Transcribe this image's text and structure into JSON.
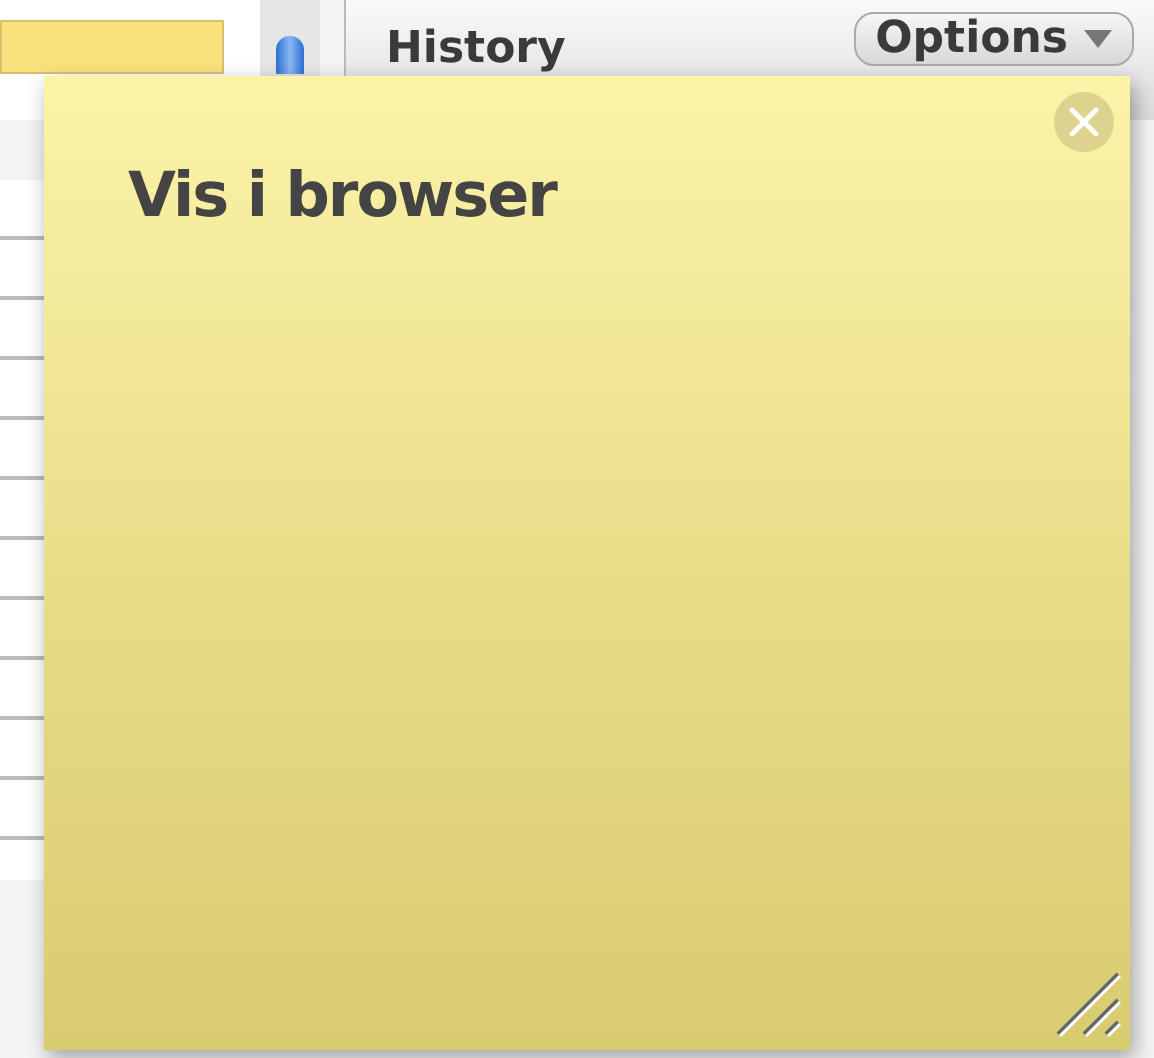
{
  "background": {
    "history_label": "History",
    "options_button": "Options"
  },
  "note": {
    "text": "Vis i browser"
  }
}
